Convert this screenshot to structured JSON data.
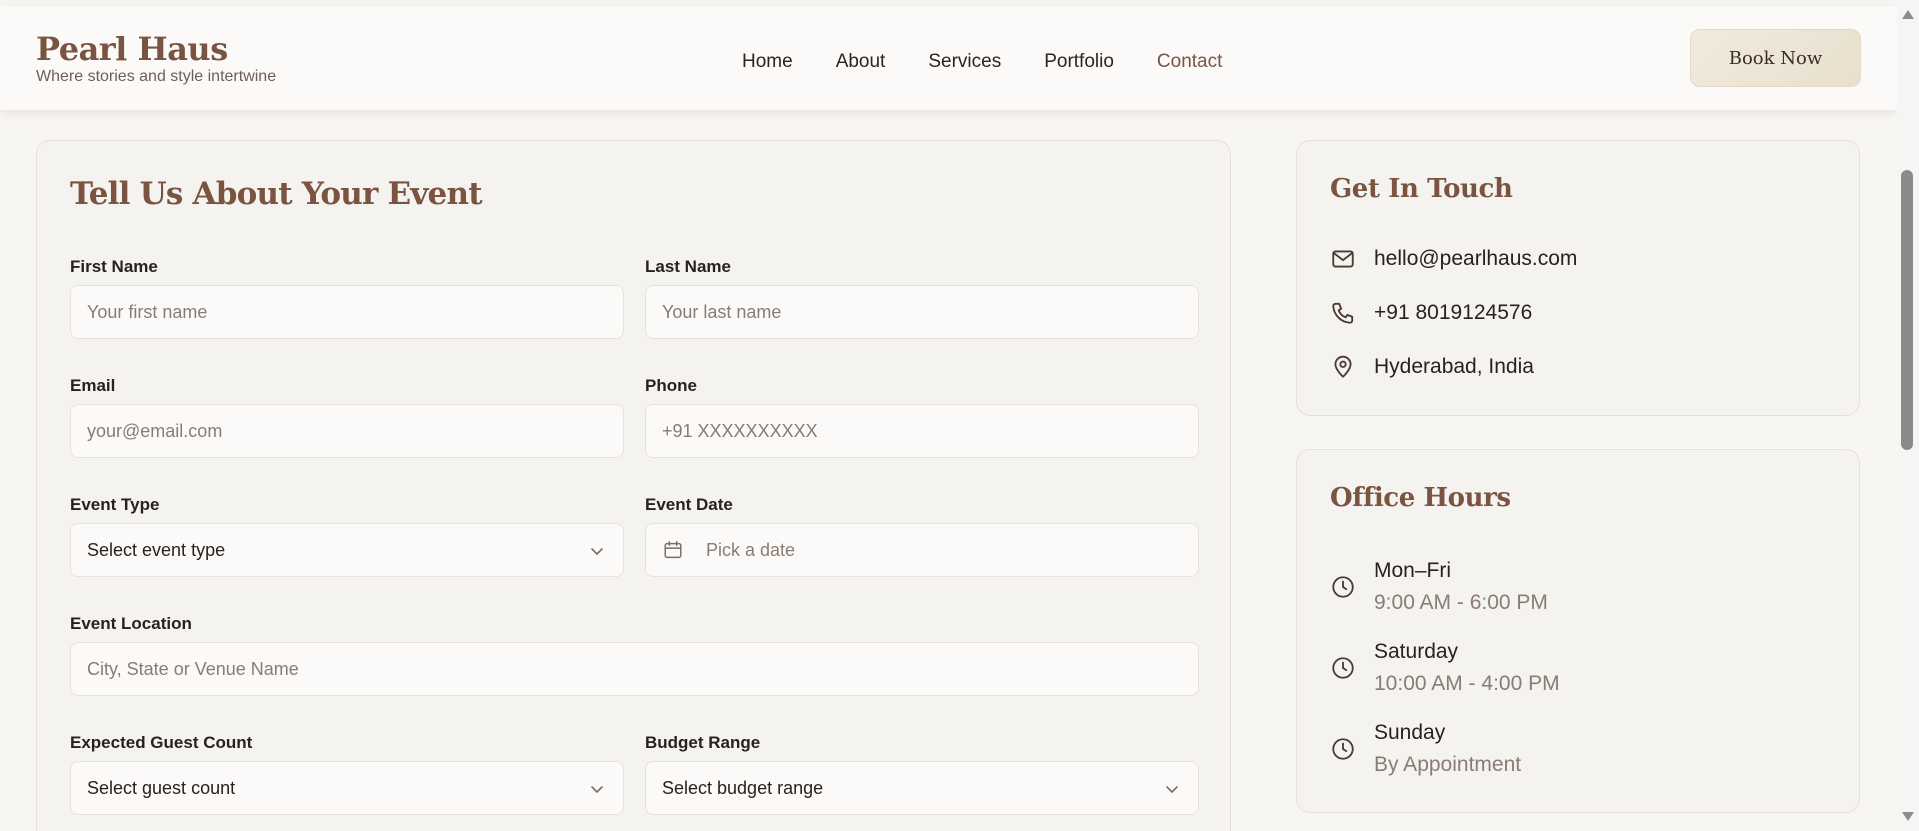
{
  "brand": {
    "name": "Pearl Haus",
    "tagline": "Where stories and style intertwine"
  },
  "nav": [
    {
      "label": "Home",
      "active": false
    },
    {
      "label": "About",
      "active": false
    },
    {
      "label": "Services",
      "active": false
    },
    {
      "label": "Portfolio",
      "active": false
    },
    {
      "label": "Contact",
      "active": true
    }
  ],
  "book_button": "Book Now",
  "form": {
    "title": "Tell Us About Your Event",
    "first_name": {
      "label": "First Name",
      "placeholder": "Your first name"
    },
    "last_name": {
      "label": "Last Name",
      "placeholder": "Your last name"
    },
    "email": {
      "label": "Email",
      "placeholder": "your@email.com"
    },
    "phone": {
      "label": "Phone",
      "placeholder": "+91 XXXXXXXXXX"
    },
    "event_type": {
      "label": "Event Type",
      "value": "Select event type"
    },
    "event_date": {
      "label": "Event Date",
      "placeholder": "Pick a date"
    },
    "event_location": {
      "label": "Event Location",
      "placeholder": "City, State or Venue Name"
    },
    "guest_count": {
      "label": "Expected Guest Count",
      "value": "Select guest count"
    },
    "budget": {
      "label": "Budget Range",
      "value": "Select budget range"
    }
  },
  "contact": {
    "title": "Get In Touch",
    "email": "hello@pearlhaus.com",
    "phone": "+91 8019124576",
    "location": "Hyderabad, India"
  },
  "hours": {
    "title": "Office Hours",
    "rows": [
      {
        "day": "Mon–Fri",
        "time": "9:00 AM - 6:00 PM"
      },
      {
        "day": "Saturday",
        "time": "10:00 AM - 4:00 PM"
      },
      {
        "day": "Sunday",
        "time": "By Appointment"
      }
    ]
  },
  "colors": {
    "accent": "#7a5440",
    "background": "#f8f6f3",
    "card": "#f5f3f0",
    "button": "#ede5d6"
  }
}
